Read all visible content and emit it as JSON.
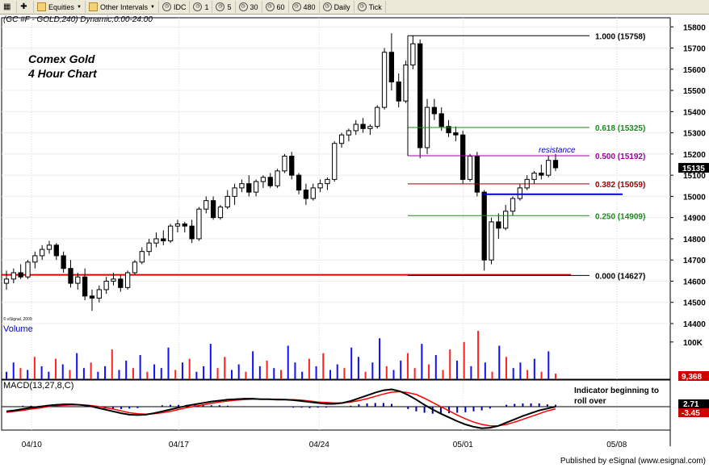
{
  "toolbar": {
    "items": [
      {
        "label": "",
        "icon": "grid-icon"
      },
      {
        "label": "",
        "icon": "plus-icon"
      },
      {
        "label": "Equities",
        "icon": "folder-icon",
        "dropdown": true
      },
      {
        "label": "Other Intervals",
        "icon": "folder-icon",
        "dropdown": true
      },
      {
        "label": "IDC",
        "icon": "clock-icon"
      },
      {
        "label": "1",
        "icon": "clock-icon"
      },
      {
        "label": "5",
        "icon": "clock-icon"
      },
      {
        "label": "30",
        "icon": "clock-icon"
      },
      {
        "label": "60",
        "icon": "clock-icon"
      },
      {
        "label": "480",
        "icon": "clock-icon"
      },
      {
        "label": "Daily",
        "icon": "clock-icon"
      },
      {
        "label": "Tick",
        "icon": "clock-icon"
      }
    ]
  },
  "header": "(GC #F - GOLD,240) Dynamic,0:00-24:00",
  "title_lines": [
    "Comex Gold",
    "4 Hour Chart"
  ],
  "copyright": "© eSignal, 2009",
  "footer": "Published by eSignal (www.esignal.com)",
  "colors": {
    "up": "#ffffff",
    "down": "#000000",
    "support": "#e00000",
    "fib_100": "#000000",
    "fib_618": "#1a8a1a",
    "fib_500": "#a000a0",
    "fib_382": "#a00000",
    "fib_250": "#1a8a1a",
    "fib_000": "#000000",
    "resistance": "#0000cc",
    "vol_up": "#1010ff",
    "vol_down": "#ff2020",
    "macd": "#000000",
    "signal": "#ff0000",
    "hist": "#0000a0"
  },
  "chart_data": {
    "type": "candlestick",
    "price": {
      "ylim": [
        14400,
        15820
      ],
      "ticks": [
        14400,
        14500,
        14600,
        14700,
        14800,
        14900,
        15000,
        15100,
        15200,
        15300,
        15400,
        15500,
        15600,
        15700,
        15800
      ],
      "current_label": "15135",
      "xlim": [
        0,
        100
      ],
      "x_labels": [
        {
          "text": "04/10",
          "x": 4.5
        },
        {
          "text": "04/17",
          "x": 26.5
        },
        {
          "text": "04/24",
          "x": 47.5
        },
        {
          "text": "05/01",
          "x": 69
        },
        {
          "text": "05/08",
          "x": 92
        }
      ],
      "support_level": 14630,
      "resistance_annotation": "resistance",
      "resistance_level": 15010,
      "fib_levels": [
        {
          "label": "1.000 (15758)",
          "value": 15758,
          "key": "fib_100"
        },
        {
          "label": "0.618 (15325)",
          "value": 15325,
          "key": "fib_618"
        },
        {
          "label": "0.500 (15192)",
          "value": 15192,
          "key": "fib_500"
        },
        {
          "label": "0.382 (15059)",
          "value": 15059,
          "key": "fib_382"
        },
        {
          "label": "0.250 (14909)",
          "value": 14909,
          "key": "fib_250"
        },
        {
          "label": "0.000 (14627)",
          "value": 14627,
          "key": "fib_000"
        }
      ],
      "candles": [
        [
          14590,
          14650,
          14560,
          14610
        ],
        [
          14610,
          14660,
          14590,
          14640
        ],
        [
          14640,
          14680,
          14610,
          14620
        ],
        [
          14620,
          14700,
          14610,
          14690
        ],
        [
          14690,
          14740,
          14660,
          14720
        ],
        [
          14720,
          14770,
          14700,
          14750
        ],
        [
          14750,
          14790,
          14730,
          14770
        ],
        [
          14770,
          14780,
          14700,
          14720
        ],
        [
          14720,
          14740,
          14640,
          14660
        ],
        [
          14660,
          14700,
          14570,
          14590
        ],
        [
          14590,
          14640,
          14560,
          14620
        ],
        [
          14620,
          14660,
          14510,
          14530
        ],
        [
          14530,
          14560,
          14460,
          14520
        ],
        [
          14520,
          14580,
          14500,
          14560
        ],
        [
          14560,
          14620,
          14540,
          14600
        ],
        [
          14600,
          14640,
          14580,
          14610
        ],
        [
          14610,
          14630,
          14550,
          14570
        ],
        [
          14570,
          14650,
          14560,
          14640
        ],
        [
          14640,
          14700,
          14630,
          14690
        ],
        [
          14690,
          14760,
          14680,
          14740
        ],
        [
          14740,
          14800,
          14720,
          14780
        ],
        [
          14780,
          14830,
          14760,
          14800
        ],
        [
          14800,
          14840,
          14770,
          14790
        ],
        [
          14790,
          14870,
          14780,
          14860
        ],
        [
          14860,
          14890,
          14830,
          14870
        ],
        [
          14870,
          14880,
          14830,
          14860
        ],
        [
          14860,
          14890,
          14780,
          14800
        ],
        [
          14800,
          14950,
          14790,
          14940
        ],
        [
          14940,
          15000,
          14920,
          14980
        ],
        [
          14980,
          15000,
          14890,
          14900
        ],
        [
          14900,
          14960,
          14890,
          14950
        ],
        [
          14950,
          15030,
          14940,
          15000
        ],
        [
          15000,
          15060,
          14960,
          15040
        ],
        [
          15040,
          15080,
          15020,
          15060
        ],
        [
          15060,
          15100,
          15000,
          15020
        ],
        [
          15020,
          15080,
          15000,
          15070
        ],
        [
          15070,
          15100,
          15040,
          15090
        ],
        [
          15090,
          15110,
          15040,
          15050
        ],
        [
          15050,
          15130,
          15040,
          15120
        ],
        [
          15120,
          15200,
          15110,
          15190
        ],
        [
          15190,
          15210,
          15080,
          15100
        ],
        [
          15100,
          15110,
          15010,
          15030
        ],
        [
          15030,
          15060,
          14960,
          14990
        ],
        [
          14990,
          15060,
          14980,
          15040
        ],
        [
          15040,
          15080,
          15020,
          15060
        ],
        [
          15060,
          15090,
          15030,
          15080
        ],
        [
          15080,
          15260,
          15070,
          15250
        ],
        [
          15250,
          15300,
          15230,
          15290
        ],
        [
          15290,
          15320,
          15260,
          15310
        ],
        [
          15310,
          15360,
          15290,
          15340
        ],
        [
          15340,
          15370,
          15300,
          15320
        ],
        [
          15320,
          15340,
          15290,
          15330
        ],
        [
          15330,
          15430,
          15320,
          15420
        ],
        [
          15420,
          15700,
          15410,
          15680
        ],
        [
          15680,
          15770,
          15500,
          15540
        ],
        [
          15540,
          15580,
          15420,
          15450
        ],
        [
          15450,
          15640,
          15440,
          15620
        ],
        [
          15620,
          15760,
          15600,
          15720
        ],
        [
          15720,
          15740,
          15180,
          15230
        ],
        [
          15230,
          15460,
          15200,
          15420
        ],
        [
          15420,
          15460,
          15360,
          15390
        ],
        [
          15390,
          15420,
          15310,
          15330
        ],
        [
          15330,
          15360,
          15280,
          15300
        ],
        [
          15300,
          15330,
          15260,
          15290
        ],
        [
          15290,
          15310,
          15060,
          15080
        ],
        [
          15080,
          15200,
          15070,
          15190
        ],
        [
          15190,
          15210,
          15000,
          15020
        ],
        [
          15020,
          15030,
          14650,
          14700
        ],
        [
          14700,
          14900,
          14680,
          14880
        ],
        [
          14880,
          14920,
          14800,
          14850
        ],
        [
          14850,
          14960,
          14840,
          14930
        ],
        [
          14930,
          15000,
          14910,
          14990
        ],
        [
          14990,
          15060,
          14980,
          15040
        ],
        [
          15040,
          15100,
          15030,
          15080
        ],
        [
          15080,
          15120,
          15060,
          15110
        ],
        [
          15110,
          15150,
          15080,
          15100
        ],
        [
          15100,
          15190,
          15090,
          15170
        ],
        [
          15170,
          15200,
          15120,
          15135
        ]
      ]
    },
    "volume": {
      "title": "Volume",
      "tick": "100K",
      "current_label": "9,368",
      "max": 130,
      "bars": [
        [
          20,
          1
        ],
        [
          45,
          1
        ],
        [
          30,
          0
        ],
        [
          25,
          1
        ],
        [
          60,
          0
        ],
        [
          35,
          1
        ],
        [
          20,
          1
        ],
        [
          55,
          0
        ],
        [
          40,
          1
        ],
        [
          25,
          0
        ],
        [
          70,
          1
        ],
        [
          30,
          1
        ],
        [
          45,
          0
        ],
        [
          20,
          1
        ],
        [
          35,
          1
        ],
        [
          80,
          0
        ],
        [
          25,
          1
        ],
        [
          50,
          1
        ],
        [
          30,
          0
        ],
        [
          65,
          1
        ],
        [
          20,
          0
        ],
        [
          40,
          1
        ],
        [
          30,
          1
        ],
        [
          85,
          1
        ],
        [
          25,
          0
        ],
        [
          45,
          1
        ],
        [
          55,
          0
        ],
        [
          20,
          1
        ],
        [
          35,
          1
        ],
        [
          95,
          1
        ],
        [
          30,
          0
        ],
        [
          60,
          0
        ],
        [
          25,
          1
        ],
        [
          40,
          1
        ],
        [
          20,
          0
        ],
        [
          75,
          1
        ],
        [
          35,
          1
        ],
        [
          50,
          0
        ],
        [
          30,
          1
        ],
        [
          25,
          0
        ],
        [
          90,
          1
        ],
        [
          45,
          1
        ],
        [
          20,
          1
        ],
        [
          55,
          0
        ],
        [
          35,
          1
        ],
        [
          70,
          0
        ],
        [
          25,
          1
        ],
        [
          40,
          1
        ],
        [
          30,
          0
        ],
        [
          85,
          1
        ],
        [
          60,
          1
        ],
        [
          20,
          0
        ],
        [
          45,
          1
        ],
        [
          110,
          1
        ],
        [
          35,
          0
        ],
        [
          25,
          1
        ],
        [
          50,
          1
        ],
        [
          70,
          0
        ],
        [
          30,
          0
        ],
        [
          95,
          1
        ],
        [
          40,
          0
        ],
        [
          65,
          1
        ],
        [
          25,
          0
        ],
        [
          80,
          0
        ],
        [
          50,
          1
        ],
        [
          100,
          0
        ],
        [
          35,
          1
        ],
        [
          130,
          0
        ],
        [
          45,
          1
        ],
        [
          20,
          0
        ],
        [
          90,
          1
        ],
        [
          60,
          0
        ],
        [
          30,
          1
        ],
        [
          45,
          1
        ],
        [
          25,
          0
        ],
        [
          55,
          1
        ],
        [
          20,
          0
        ],
        [
          75,
          1
        ],
        [
          15,
          0
        ]
      ]
    },
    "macd": {
      "title": "MACD(13,27,8,C)",
      "current_macd": "2.71",
      "current_signal": "-3.45",
      "annotation": "Indicator beginning to roll over",
      "ylim": [
        -50,
        50
      ],
      "macd": [
        -10,
        -8,
        -5,
        -2,
        0,
        2,
        4,
        5,
        5,
        4,
        2,
        -2,
        -6,
        -10,
        -14,
        -17,
        -18,
        -17,
        -14,
        -10,
        -6,
        -2,
        2,
        5,
        8,
        11,
        13,
        15,
        16,
        17,
        17,
        16,
        16,
        15,
        15,
        14,
        12,
        10,
        8,
        6,
        6,
        8,
        12,
        18,
        24,
        30,
        35,
        37,
        33,
        25,
        15,
        4,
        -6,
        -15,
        -23,
        -31,
        -38,
        -43,
        -46,
        -45,
        -41,
        -34,
        -27,
        -20,
        -14,
        -8,
        -4,
        0
      ],
      "signal": [
        -12,
        -10,
        -8,
        -5,
        -3,
        0,
        2,
        3,
        4,
        4,
        3,
        1,
        -2,
        -5,
        -9,
        -13,
        -15,
        -16,
        -15,
        -13,
        -10,
        -6,
        -2,
        1,
        4,
        7,
        10,
        12,
        14,
        15,
        16,
        16,
        16,
        16,
        15,
        15,
        14,
        12,
        10,
        9,
        8,
        8,
        10,
        13,
        17,
        22,
        27,
        31,
        32,
        30,
        26,
        18,
        9,
        0,
        -9,
        -18,
        -26,
        -33,
        -38,
        -41,
        -41,
        -38,
        -33,
        -27,
        -21,
        -15,
        -9,
        -5
      ],
      "hist": [
        1,
        1,
        2,
        2,
        2,
        1,
        1,
        1,
        0,
        0,
        -1,
        -2,
        -4,
        -5,
        -5,
        -4,
        -3,
        -1,
        1,
        3,
        4,
        4,
        4,
        4,
        4,
        3,
        3,
        2,
        1,
        1,
        0,
        0,
        -1,
        -1,
        -1,
        -2,
        -2,
        -3,
        -2,
        -2,
        -1,
        0,
        2,
        5,
        7,
        8,
        8,
        6,
        1,
        -5,
        -10,
        -13,
        -15,
        -16,
        -14,
        -13,
        -12,
        -10,
        -8,
        -4,
        0,
        4,
        6,
        7,
        7,
        7,
        5,
        4
      ]
    }
  }
}
